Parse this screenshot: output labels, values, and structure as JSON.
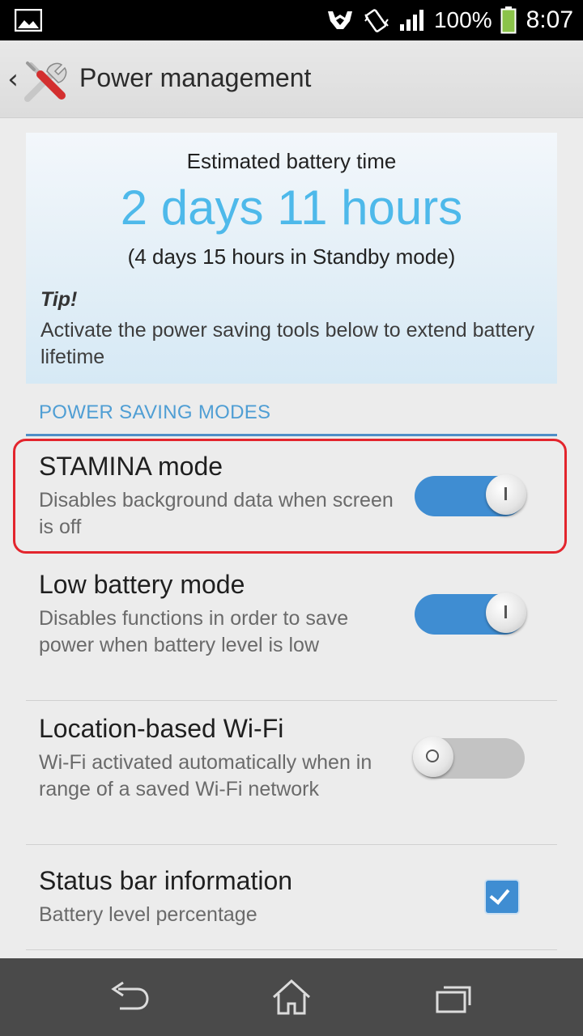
{
  "status_bar": {
    "battery_percent": "100%",
    "time": "8:07",
    "icons": [
      "image-icon",
      "handshake-icon",
      "vibrate-icon",
      "signal-icon",
      "battery-icon"
    ]
  },
  "action_bar": {
    "title": "Power management",
    "icon": "tools-icon"
  },
  "battery": {
    "label": "Estimated battery time",
    "estimate": "2 days 11 hours",
    "standby": "(4 days 15 hours in Standby mode)",
    "tip_title": "Tip!",
    "tip_text": "Activate the power saving tools below to extend battery lifetime"
  },
  "section": {
    "header": "POWER SAVING MODES"
  },
  "settings": [
    {
      "title": "STAMINA mode",
      "subtitle": "Disables background data when screen is off",
      "control": "toggle",
      "on": true
    },
    {
      "title": "Low battery mode",
      "subtitle": "Disables functions in order to save power when battery level is low",
      "control": "toggle",
      "on": true
    },
    {
      "title": "Location-based Wi-Fi",
      "subtitle": "Wi-Fi activated automatically when in range of a saved Wi-Fi network",
      "control": "toggle",
      "on": false
    },
    {
      "title": "Status bar information",
      "subtitle": "Battery level percentage",
      "control": "checkbox",
      "checked": true
    }
  ],
  "colors": {
    "accent": "#3f8dd2",
    "estimate": "#4eb9ea",
    "highlight": "#e3252d"
  },
  "nav_bar": {
    "icons": [
      "back-icon",
      "home-icon",
      "recents-icon"
    ]
  }
}
